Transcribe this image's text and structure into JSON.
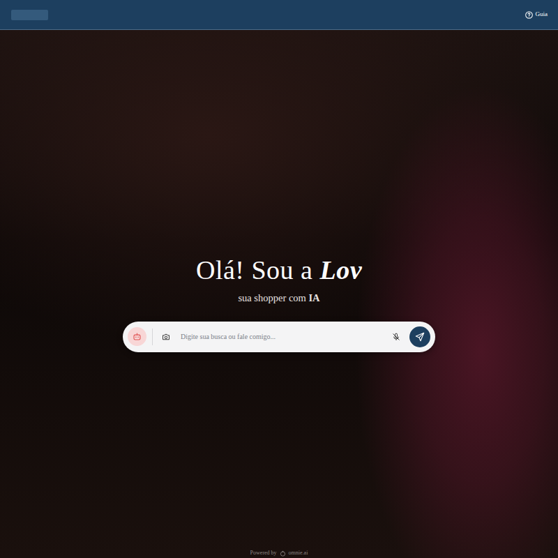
{
  "nav": {
    "help_label": "Guia"
  },
  "hero": {
    "greeting": "Olá! Sou a ",
    "name": "Lov",
    "subtitle": "sua shopper com ",
    "subtitle_strong": "IA"
  },
  "search": {
    "placeholder": "Digite sua busca ou fale comigo...",
    "mic_muted": true
  },
  "footer": {
    "powered_by": "Powered by",
    "brand": "omnie.ai"
  }
}
